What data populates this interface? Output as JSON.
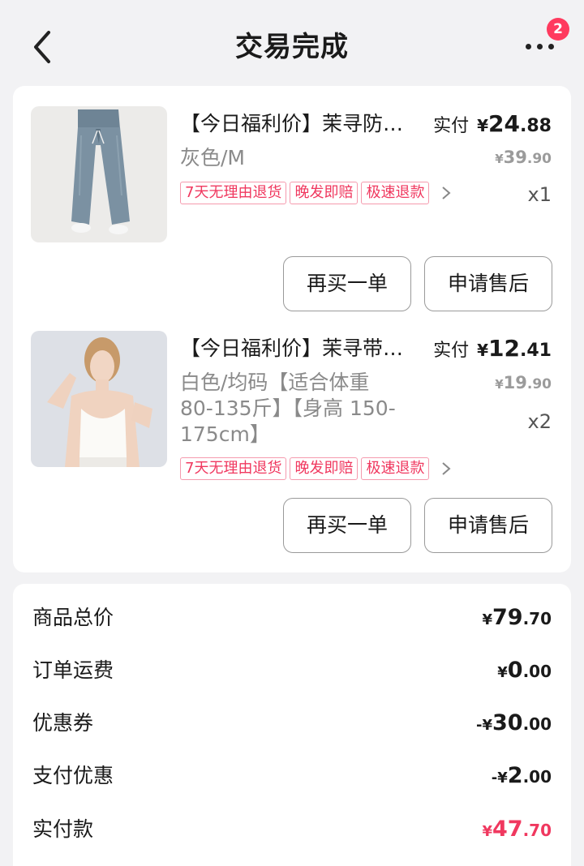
{
  "header": {
    "title": "交易完成",
    "badge_count": "2"
  },
  "items": [
    {
      "title": "【今日福利价】茉寻防…",
      "paid_label": "实付",
      "paid_yen": "¥",
      "paid_int": "24",
      "paid_dec": ".88",
      "spec": "灰色/M",
      "orig_yen": "¥",
      "orig_int": "39",
      "orig_dec": ".90",
      "qty": "x1",
      "tags": [
        "7天无理由退货",
        "晚发即赔",
        "极速退款"
      ],
      "btn_rebuy": "再买一单",
      "btn_aftersale": "申请售后"
    },
    {
      "title": "【今日福利价】茉寻带…",
      "paid_label": "实付",
      "paid_yen": "¥",
      "paid_int": "12",
      "paid_dec": ".41",
      "spec": "白色/均码【适合体重 80-135斤】【身高 150-175cm】",
      "orig_yen": "¥",
      "orig_int": "19",
      "orig_dec": ".90",
      "qty": "x2",
      "tags": [
        "7天无理由退货",
        "晚发即赔",
        "极速退款"
      ],
      "btn_rebuy": "再买一单",
      "btn_aftersale": "申请售后"
    }
  ],
  "summary": {
    "rows": [
      {
        "label": "商品总价",
        "prefix": "",
        "yen": "¥",
        "int": "79",
        "dec": ".70"
      },
      {
        "label": "订单运费",
        "prefix": "",
        "yen": "¥",
        "int": "0",
        "dec": ".00"
      },
      {
        "label": "优惠券",
        "prefix": "-",
        "yen": "¥",
        "int": "30",
        "dec": ".00"
      },
      {
        "label": "支付优惠",
        "prefix": "-",
        "yen": "¥",
        "int": "2",
        "dec": ".00"
      },
      {
        "label": "实付款",
        "prefix": "",
        "yen": "¥",
        "int": "47",
        "dec": ".70"
      }
    ]
  },
  "colors": {
    "accent": "#f0385f",
    "background": "#f2f2f4",
    "card": "#ffffff"
  }
}
